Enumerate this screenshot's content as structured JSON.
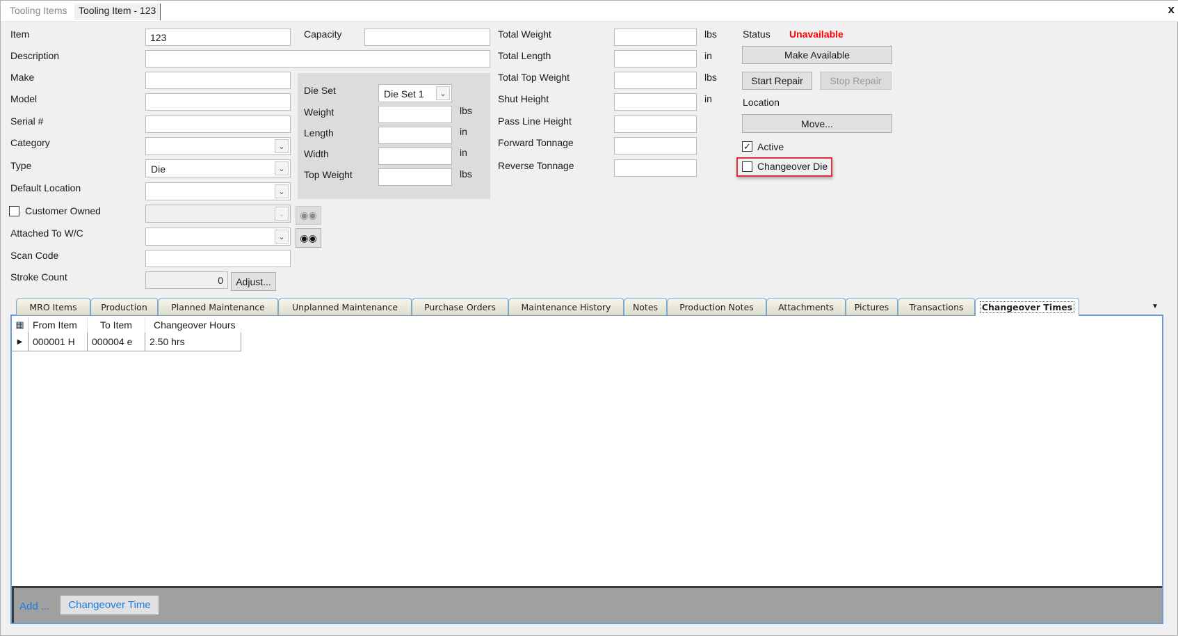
{
  "doc_tabs": [
    "Tooling Items",
    "Tooling Item - 123"
  ],
  "close_label": "x",
  "form": {
    "item": {
      "label": "Item",
      "value": "123"
    },
    "description": {
      "label": "Description",
      "value": ""
    },
    "make": {
      "label": "Make",
      "value": ""
    },
    "model": {
      "label": "Model",
      "value": ""
    },
    "serial": {
      "label": "Serial #",
      "value": ""
    },
    "category": {
      "label": "Category",
      "value": ""
    },
    "type": {
      "label": "Type",
      "value": "Die"
    },
    "default_location": {
      "label": "Default Location",
      "value": ""
    },
    "customer_owned": {
      "label": "Customer Owned",
      "checked": false
    },
    "attached_wc": {
      "label": "Attached To W/C",
      "value": ""
    },
    "scan_code": {
      "label": "Scan Code",
      "value": ""
    },
    "stroke_count": {
      "label": "Stroke Count",
      "value": "0",
      "adjust": "Adjust..."
    },
    "capacity": {
      "label": "Capacity",
      "value": ""
    }
  },
  "die_set": {
    "label": "Die Set",
    "value": "Die Set 1",
    "weight": {
      "label": "Weight",
      "unit": "lbs"
    },
    "length": {
      "label": "Length",
      "unit": "in"
    },
    "width": {
      "label": "Width",
      "unit": "in"
    },
    "top_weight": {
      "label": "Top Weight",
      "unit": "lbs"
    }
  },
  "totals": {
    "total_weight": {
      "label": "Total Weight",
      "unit": "lbs"
    },
    "total_length": {
      "label": "Total Length",
      "unit": "in"
    },
    "total_top_weight": {
      "label": "Total Top Weight",
      "unit": "lbs"
    },
    "shut_height": {
      "label": "Shut Height",
      "unit": "in"
    },
    "pass_line_height": {
      "label": "Pass Line Height"
    },
    "forward_tonnage": {
      "label": "Forward Tonnage"
    },
    "reverse_tonnage": {
      "label": "Reverse Tonnage"
    }
  },
  "status": {
    "label": "Status",
    "value": "Unavailable",
    "color": "#ff0000",
    "make_available": "Make Available",
    "start_repair": "Start Repair",
    "stop_repair": "Stop Repair",
    "location": "Location",
    "move": "Move...",
    "active": {
      "label": "Active",
      "checked": true
    },
    "changeover_die": {
      "label": "Changeover Die",
      "checked": false,
      "highlight": "#e0303a"
    }
  },
  "tabs": [
    "MRO Items",
    "Production",
    "Planned Maintenance",
    "Unplanned Maintenance",
    "Purchase Orders",
    "Maintenance History",
    "Notes",
    "Production Notes",
    "Attachments",
    "Pictures",
    "Transactions",
    "Changeover Times"
  ],
  "active_tab": "Changeover Times",
  "grid": {
    "columns": [
      "From Item",
      "To Item",
      "Changeover Hours"
    ],
    "rows": [
      [
        "000001 H",
        "000004 e",
        "2.50 hrs"
      ]
    ]
  },
  "toolbar": {
    "add": "Add ...",
    "changeover_time": "Changeover Time",
    "link_color": "#1e7be0"
  }
}
